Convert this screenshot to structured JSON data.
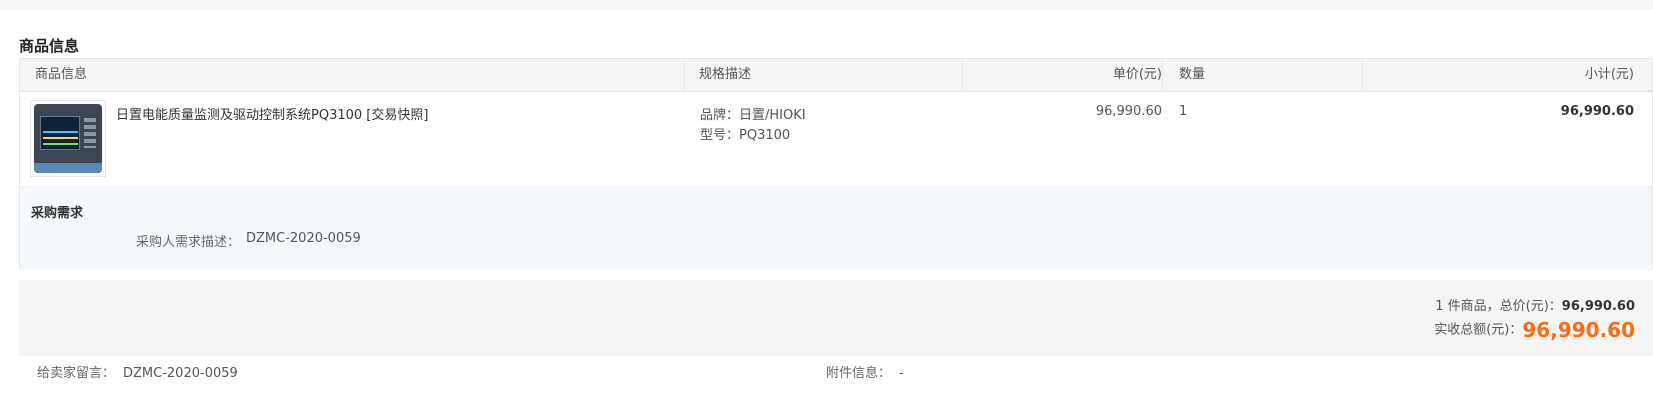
{
  "section": {
    "title": "商品信息"
  },
  "table": {
    "headers": {
      "product": "商品信息",
      "spec": "规格描述",
      "unit_price": "单价(元)",
      "quantity": "数量",
      "subtotal": "小计(元)"
    },
    "rows": [
      {
        "title": "日置电能质量监测及驱动控制系统PQ3100 [交易快照]",
        "brand": "品牌：日置/HIOKI",
        "model": "型号：PQ3100",
        "unit_price": "96,990.60",
        "quantity": "1",
        "subtotal": "96,990.60"
      }
    ]
  },
  "requirement": {
    "title": "采购需求",
    "label": "采购人需求描述：",
    "value": "DZMC-2020-0059"
  },
  "summary": {
    "count_text": "1 件商品，总价(元)：",
    "total": "96,990.60",
    "received_label": "实收总额(元)：",
    "received_total": "96,990.60",
    "accent_color": "#ff6a13"
  },
  "footer": {
    "seller_message_label": "给卖家留言：",
    "seller_message_value": "DZMC-2020-0059",
    "attachment_label": "附件信息：",
    "attachment_value": "-"
  }
}
